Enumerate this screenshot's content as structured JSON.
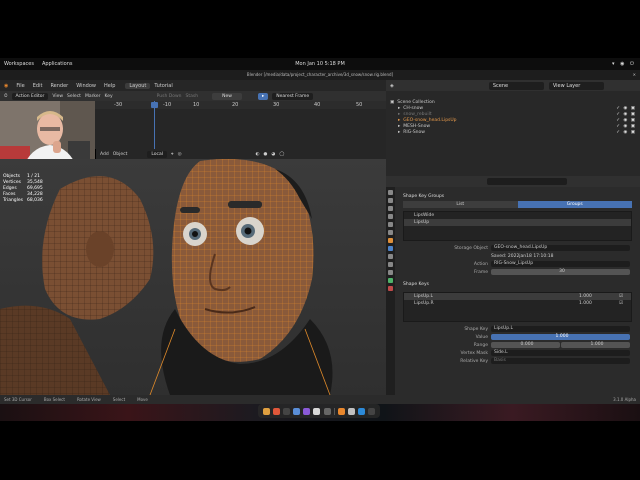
{
  "gnome": {
    "workspaces": "Workspaces",
    "applications": "Applications",
    "clock": "Mon Jan 10  5:18 PM"
  },
  "window_title": "Blender [/media/data/project_character_archive/3d_snow/snow.rig.blend]",
  "menu": {
    "items": [
      "File",
      "Edit",
      "Render",
      "Window",
      "Help"
    ],
    "tabs": [
      "Layout",
      "Tutorial"
    ]
  },
  "timeline": {
    "editor": "Action Editor",
    "menus": [
      "View",
      "Select",
      "Marker",
      "Key"
    ],
    "push_down": "Push Down",
    "stash": "Stash",
    "new": "New",
    "interpolation": "Nearest Frame",
    "ticks": [
      "-30",
      "-10",
      "0",
      "10",
      "20",
      "30",
      "40",
      "50"
    ]
  },
  "viewport": {
    "menus": [
      "Add",
      "Object"
    ],
    "orientation": "Local",
    "stats": [
      {
        "k": "Objects",
        "v": "1 / 21"
      },
      {
        "k": "Vertices",
        "v": "35,548"
      },
      {
        "k": "Edges",
        "v": "69,695"
      },
      {
        "k": "Faces",
        "v": "34,228"
      },
      {
        "k": "Triangles",
        "v": "68,036"
      }
    ]
  },
  "outliner": {
    "scene": "Scene",
    "view_layer": "View Layer",
    "rows": [
      "Scene Collection",
      "CH-snow",
      "snow_rebuilt",
      "GEO-snow_head.LipsUp",
      "MESH-Snow",
      "RIG-Snow"
    ]
  },
  "properties": {
    "shape_key_groups": "Shape Key Groups",
    "toggle_list": "List",
    "toggle_groups": "Groups",
    "groups": [
      "LipsWide",
      "LipsUp"
    ],
    "storage_object_label": "Storage Object",
    "storage_object": "GEO-snow_head.LipsUp",
    "saved": "Saved: 2022jan18 17:10:18",
    "action_label": "Action",
    "action": "RIG-Snow_LipsUp",
    "frame_label": "Frame",
    "frame": "30",
    "shape_keys_title": "Shape Keys",
    "keys": [
      {
        "name": "LipsUp.L",
        "val": "1.000"
      },
      {
        "name": "LipsUp.R",
        "val": "1.000"
      }
    ],
    "shape_key_label": "Shape Key",
    "shape_key": "LipsUp.L",
    "value_label": "Value",
    "value": "1.000",
    "range_label": "Range",
    "range_min": "0.000",
    "range_max": "1.000",
    "vertex_mask_label": "Vertex Mask",
    "vertex_mask": "Side.L",
    "relative_key_label": "Relative Key",
    "relative_key": "Basis"
  },
  "status": {
    "items": [
      "Set 3D Cursor",
      "Box Select",
      "Rotate View",
      "Select",
      "Move"
    ],
    "version": "3.1.0 Alpha"
  },
  "colors": {
    "accent": "#4772b3",
    "wire": "#e08a2a"
  }
}
